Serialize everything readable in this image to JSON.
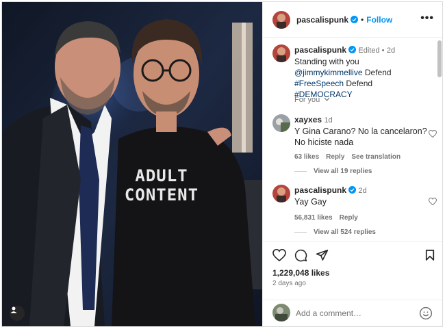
{
  "post": {
    "author": "pascalispunk",
    "follow_label": "Follow",
    "dot": "•",
    "more_label": "•••",
    "shirt_line1": "ADULT",
    "shirt_line2": "CONTENT"
  },
  "caption": {
    "author": "pascalispunk",
    "edited": "Edited •",
    "age": "2d",
    "text_prefix": "Standing with you ",
    "mention": "@jimmykimmellive",
    "text_mid1": " Defend ",
    "hashtag1": "#FreeSpeech",
    "text_mid2": " Defend ",
    "hashtag2": "#DEMOCRACY"
  },
  "for_you_label": "For you",
  "comments": [
    {
      "author": "xayxes",
      "age": "1d",
      "text": "Y Gina Carano? No la cancelaron? No hiciste nada",
      "likes": "63 likes",
      "reply_label": "Reply",
      "translate_label": "See translation",
      "view_replies": "View all 19 replies"
    },
    {
      "author": "pascalispunk",
      "age": "2d",
      "text": "Yay Gay",
      "likes": "56,831 likes",
      "reply_label": "Reply",
      "view_replies": "View all 524 replies"
    }
  ],
  "engagement": {
    "likes": "1,229,048 likes",
    "date": "2 days ago"
  },
  "comment_box": {
    "placeholder": "Add a comment…"
  },
  "icons": {
    "verified": "verified-badge-icon",
    "like": "heart-icon",
    "comment": "comment-bubble-icon",
    "share": "paper-plane-icon",
    "save": "bookmark-icon",
    "emoji": "smiley-icon",
    "tag": "user-tag-icon"
  },
  "colors": {
    "link": "#0095f6",
    "mention": "#00376b",
    "verified": "#0095f6",
    "muted": "#737373"
  }
}
